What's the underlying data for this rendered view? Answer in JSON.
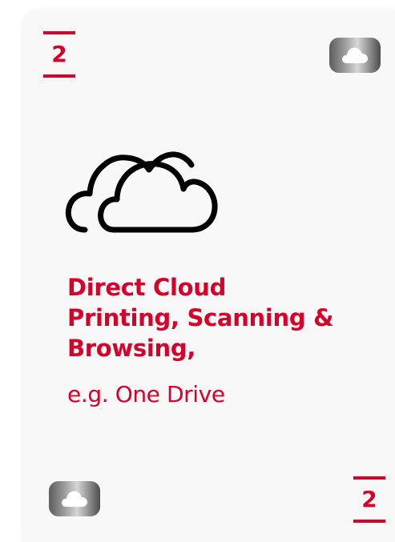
{
  "card": {
    "number_top": "2",
    "number_bottom": "2",
    "title_lines": [
      "Direct Cloud",
      "Printing, Scanning &",
      "Browsing,"
    ],
    "subtitle": "e.g. One Drive",
    "icon": "cloud-icon"
  },
  "colors": {
    "accent": "#d6002a",
    "card_background": "#f8f8f8",
    "icon_stroke": "#000000"
  }
}
